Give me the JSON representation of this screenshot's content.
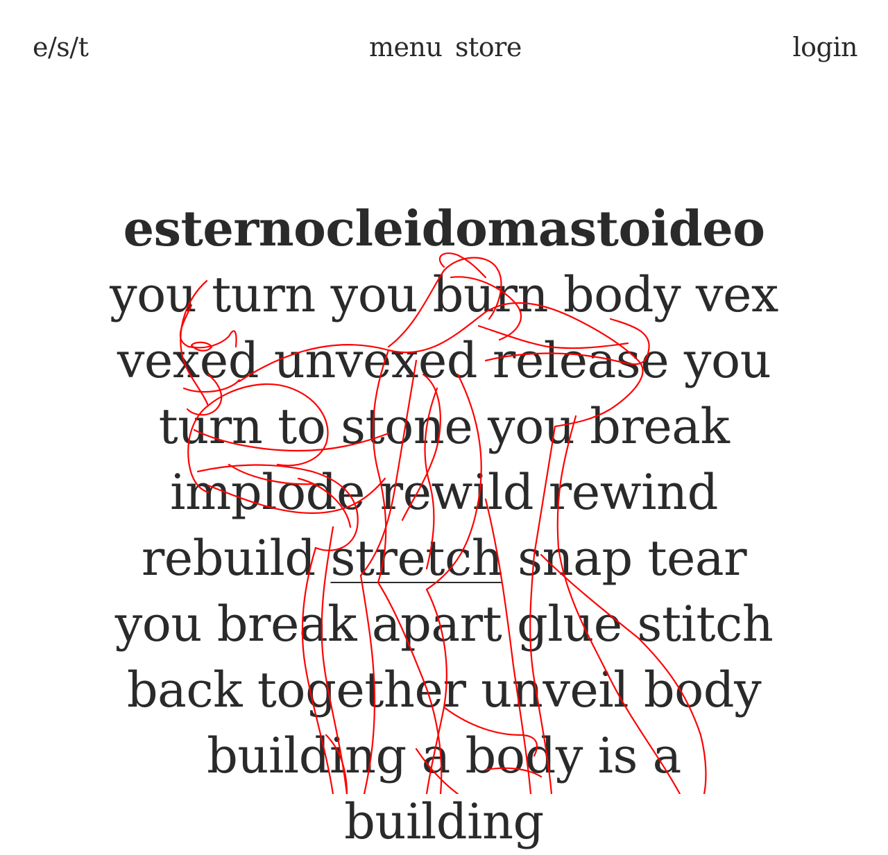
{
  "nav": {
    "logo": "e/s/t",
    "menu": "menu",
    "store": "store",
    "login": "login"
  },
  "poem": {
    "title_word": "esternocleidomastoideo",
    "before_link": " you turn you burn body vex vexed unvexed release you turn to stone you break implode rewild rewind rebuild ",
    "link": "stretch",
    "after_link": " snap tear you break apart glue stitch back together unveil body building a body is a building"
  },
  "illustration": {
    "name": "line-drawing-figure",
    "stroke_color": "#ff0000"
  }
}
